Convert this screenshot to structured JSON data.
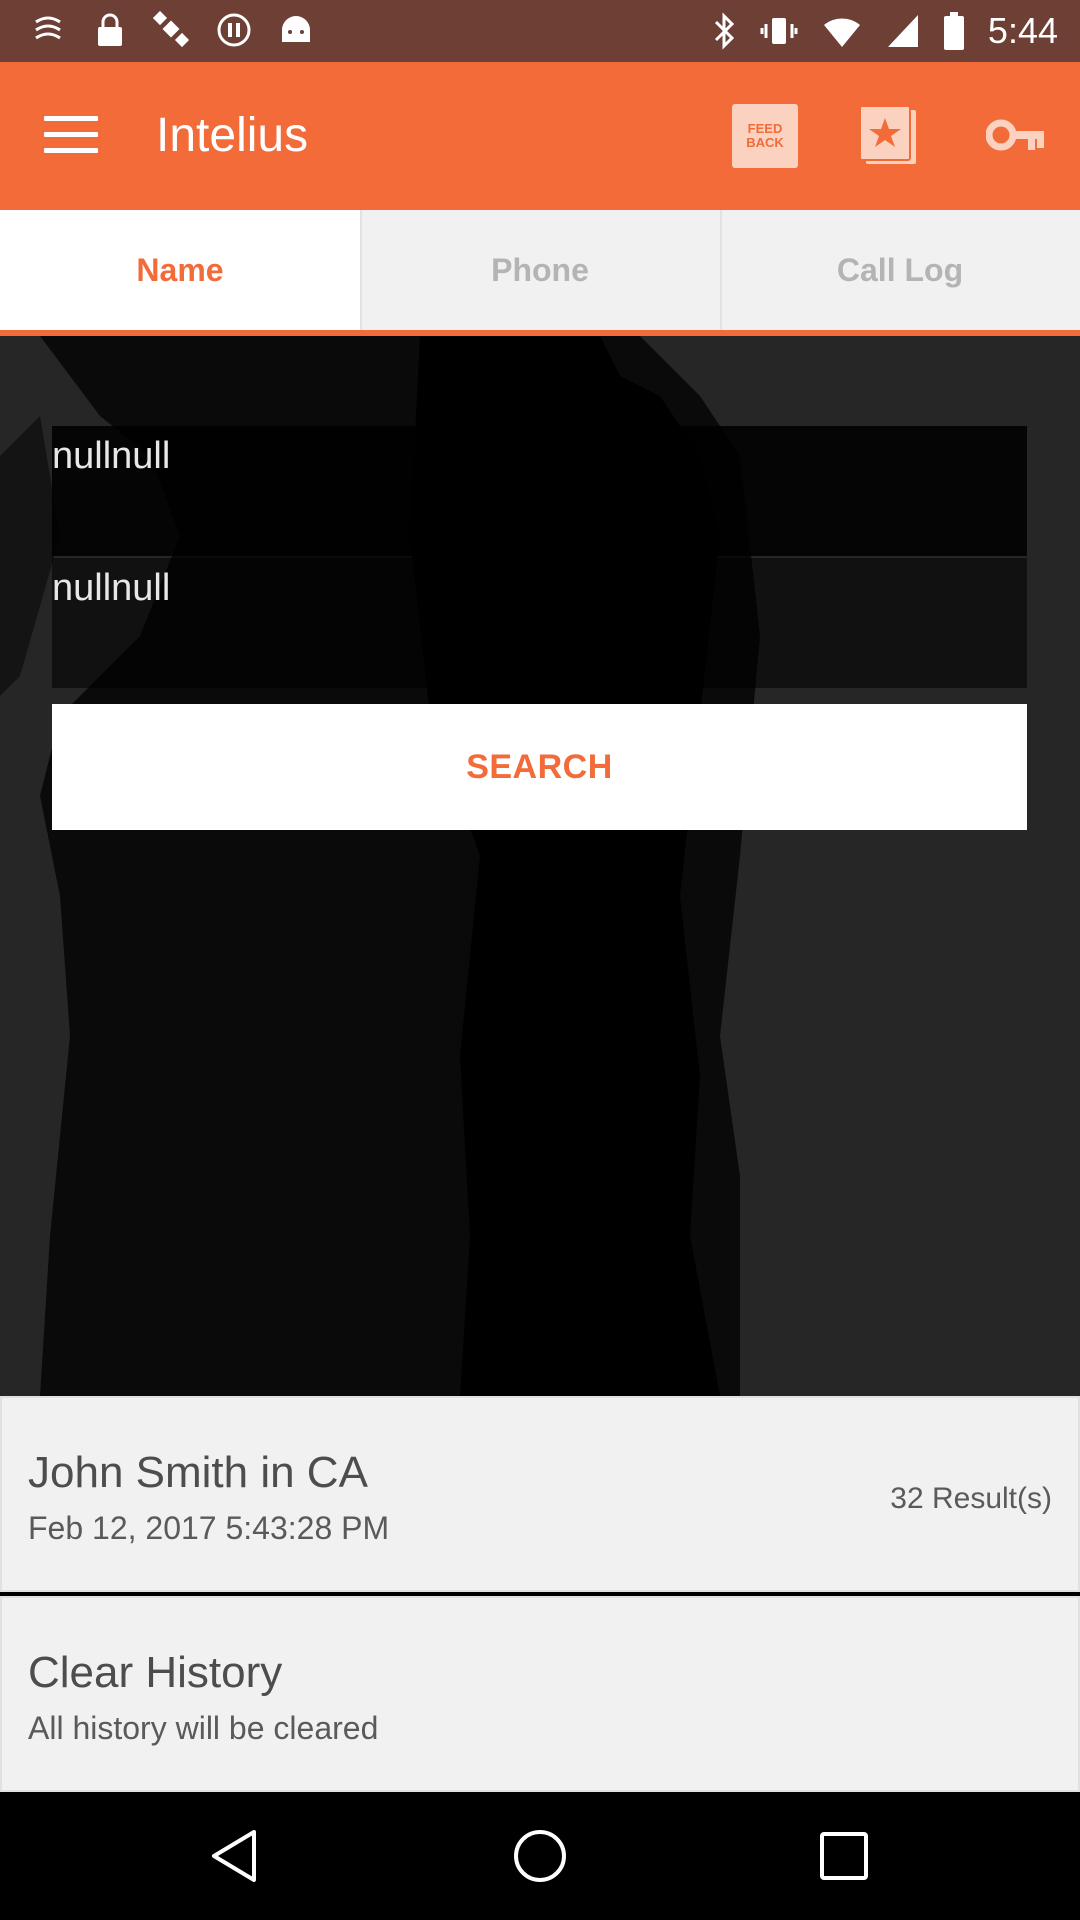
{
  "status_bar": {
    "time": "5:44",
    "icons": [
      "notification-icon",
      "lock-icon",
      "fake-gps-icon",
      "pause-icon",
      "android-icon",
      "bluetooth-icon",
      "vibrate-icon",
      "wifi-icon",
      "signal-icon",
      "battery-icon"
    ]
  },
  "app_bar": {
    "title": "Intelius",
    "feedback_line1": "FEED",
    "feedback_line2": "BACK",
    "accent_color": "#f26b38"
  },
  "tabs": [
    {
      "label": "Name",
      "active": true
    },
    {
      "label": "Phone",
      "active": false
    },
    {
      "label": "Call Log",
      "active": false
    }
  ],
  "form": {
    "first_field_value": "nullnull",
    "second_field_value": "nullnull",
    "search_label": "SEARCH"
  },
  "history": [
    {
      "title": "John Smith in CA",
      "subtitle": "Feb 12, 2017 5:43:28 PM",
      "count": "32 Result(s)"
    },
    {
      "title": "Clear History",
      "subtitle": "All history will be cleared"
    }
  ]
}
